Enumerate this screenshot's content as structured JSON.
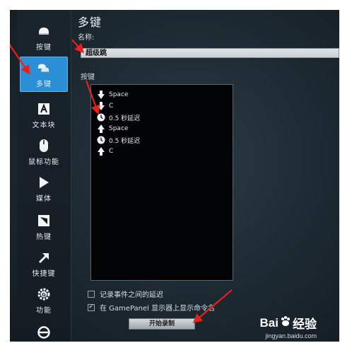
{
  "page_title": "多键",
  "name_label": "名称:",
  "name_value": "超级跳",
  "keys_label": "按键",
  "sidebar": {
    "items": [
      {
        "label": "按键",
        "icon": "key-icon",
        "active": false
      },
      {
        "label": "多键",
        "icon": "multi-key-icon",
        "active": true
      },
      {
        "label": "文本块",
        "icon": "text-block-icon",
        "active": false
      },
      {
        "label": "鼠标功能",
        "icon": "mouse-icon",
        "active": false
      },
      {
        "label": "媒体",
        "icon": "play-icon",
        "active": false
      },
      {
        "label": "热键",
        "icon": "hotkey-icon",
        "active": false
      },
      {
        "label": "快捷键",
        "icon": "shortcut-arrow-icon",
        "active": false
      },
      {
        "label": "功能",
        "icon": "function-gear-icon",
        "active": false
      }
    ]
  },
  "keys": [
    {
      "icon": "arrow-down-icon",
      "text": "Space"
    },
    {
      "icon": "arrow-down-icon",
      "text": "C"
    },
    {
      "icon": "clock-icon",
      "text": "0.5 秒延迟"
    },
    {
      "icon": "arrow-up-icon",
      "text": "Space"
    },
    {
      "icon": "clock-icon",
      "text": "0.5 秒延迟"
    },
    {
      "icon": "arrow-up-icon",
      "text": "C"
    }
  ],
  "options": [
    {
      "label": "记录事件之间的延迟",
      "checked": false
    },
    {
      "label": "在 GamePanel 显示器上显示命令名",
      "checked": true
    }
  ],
  "record_button": "开始录制",
  "watermark": {
    "brand_a": "Bai",
    "brand_b": "经验",
    "sub": "jingyan.baidu.com"
  },
  "colors": {
    "accent": "#2b8fd6",
    "annotation": "#e8201c",
    "background": "#1f2c35"
  }
}
